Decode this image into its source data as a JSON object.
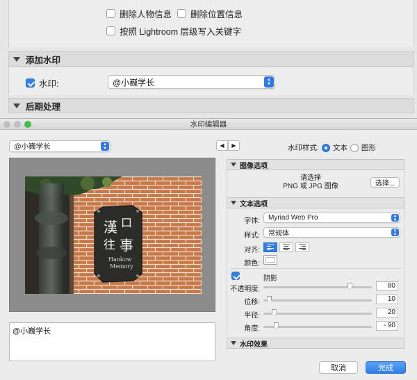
{
  "export_dialog": {
    "options": [
      {
        "label": "删除人物信息",
        "checked": false
      },
      {
        "label": "删除位置信息",
        "checked": false
      },
      {
        "label": "按照 Lightroom 层级写入关键字",
        "checked": false
      }
    ],
    "watermark_section_title": "添加水印",
    "watermark_checkbox_label": "水印:",
    "watermark_checked": true,
    "watermark_select_value": "@小巍学长",
    "post_processing_title": "后期处理"
  },
  "editor": {
    "window_title": "水印编辑器",
    "preset_select_value": "@小巍学长",
    "nav_prev": "◀",
    "nav_next": "▶",
    "style_label": "水印样式:",
    "style_text": "文本",
    "style_graphic": "图形",
    "style_selected": "text",
    "watermark_text": "@小巍学长",
    "image_options": {
      "title": "图像选项",
      "hint_line1": "请选择",
      "hint_line2": "PNG 或 JPG 图像",
      "choose_button": "选择..."
    },
    "text_options": {
      "title": "文本选项",
      "font_label": "字体:",
      "font_value": "Myriad Web Pro",
      "style_label": "样式:",
      "style_value": "常规体",
      "align_label": "对齐:",
      "align_selected": "left",
      "color_label": "颜色:"
    },
    "shadow": {
      "label": "阴影",
      "enabled": true,
      "sliders": [
        {
          "label": "不透明度:",
          "value": "80",
          "fraction": 0.8
        },
        {
          "label": "位移:",
          "value": "10",
          "fraction": 0.06
        },
        {
          "label": "半径:",
          "value": "20",
          "fraction": 0.1
        },
        {
          "label": "角度:",
          "value": "- 90",
          "fraction": 0.12
        }
      ]
    },
    "effects_title": "水印效果",
    "cancel_button": "取消",
    "done_button": "完成",
    "sign_text": {
      "chars": [
        "漢",
        "口",
        "往",
        "事"
      ],
      "latin_1": "Hankow",
      "latin_2": "Memory"
    },
    "colors": {
      "accent": "#2f7fe6",
      "brick": "#c9784a",
      "sign": "#2c2c2a"
    }
  }
}
